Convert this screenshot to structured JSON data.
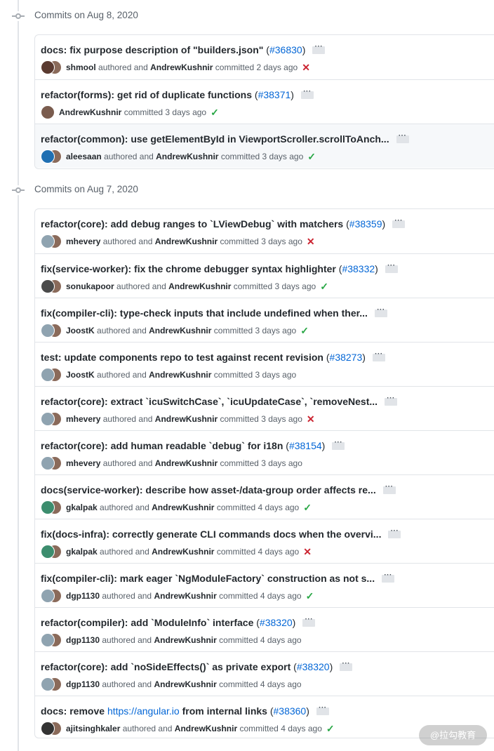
{
  "colors": {
    "link": "#0366d6",
    "fail": "#cb2431",
    "success": "#28a745",
    "border": "#e1e4e8",
    "muted": "#586069"
  },
  "groups": [
    {
      "heading": "Commits on Aug 8, 2020",
      "commits": [
        {
          "title": "docs: fix purpose description of \"builders.json\"",
          "pr": "#36830",
          "author": "shmool",
          "verb": "authored and",
          "committer": "AndrewKushnir",
          "action": "committed",
          "time": "2 days ago",
          "status": "fail",
          "avatar_color": "#5a3a30"
        },
        {
          "title": "refactor(forms): get rid of duplicate functions",
          "pr": "#38371",
          "author": "AndrewKushnir",
          "verb": "",
          "committer": "",
          "action": "committed",
          "time": "3 days ago",
          "status": "success",
          "avatar_color": "#7a5c4e"
        },
        {
          "title": "refactor(common): use getElementById in ViewportScroller.scrollToAnch...",
          "pr": "",
          "author": "aleesaan",
          "verb": "authored and",
          "committer": "AndrewKushnir",
          "action": "committed",
          "time": "3 days ago",
          "status": "success",
          "avatar_color": "#1f6fb2"
        }
      ]
    },
    {
      "heading": "Commits on Aug 7, 2020",
      "commits": [
        {
          "title": "refactor(core): add debug ranges to `LViewDebug` with matchers",
          "pr": "#38359",
          "author": "mhevery",
          "verb": "authored and",
          "committer": "AndrewKushnir",
          "action": "committed",
          "time": "3 days ago",
          "status": "fail",
          "avatar_color": "#8fa3b0"
        },
        {
          "title": "fix(service-worker): fix the chrome debugger syntax highlighter",
          "pr": "#38332",
          "author": "sonukapoor",
          "verb": "authored and",
          "committer": "AndrewKushnir",
          "action": "committed",
          "time": "3 days ago",
          "status": "success",
          "avatar_color": "#4a4a4a"
        },
        {
          "title": "fix(compiler-cli): type-check inputs that include undefined when ther...",
          "pr": "",
          "author": "JoostK",
          "verb": "authored and",
          "committer": "AndrewKushnir",
          "action": "committed",
          "time": "3 days ago",
          "status": "success",
          "avatar_color": "#8fa3b0"
        },
        {
          "title": "test: update components repo to test against recent revision",
          "pr": "#38273",
          "author": "JoostK",
          "verb": "authored and",
          "committer": "AndrewKushnir",
          "action": "committed",
          "time": "3 days ago",
          "status": "none",
          "avatar_color": "#8fa3b0"
        },
        {
          "title": "refactor(core): extract `icuSwitchCase`, `icuUpdateCase`, `removeNest...",
          "pr": "",
          "author": "mhevery",
          "verb": "authored and",
          "committer": "AndrewKushnir",
          "action": "committed",
          "time": "3 days ago",
          "status": "fail",
          "avatar_color": "#8fa3b0"
        },
        {
          "title": "refactor(core): add human readable `debug` for i18n",
          "pr": "#38154",
          "author": "mhevery",
          "verb": "authored and",
          "committer": "AndrewKushnir",
          "action": "committed",
          "time": "3 days ago",
          "status": "none",
          "avatar_color": "#8fa3b0"
        },
        {
          "title": "docs(service-worker): describe how asset-/data-group order affects re...",
          "pr": "",
          "author": "gkalpak",
          "verb": "authored and",
          "committer": "AndrewKushnir",
          "action": "committed",
          "time": "4 days ago",
          "status": "success",
          "avatar_color": "#3c8d6e"
        },
        {
          "title": "fix(docs-infra): correctly generate CLI commands docs when the overvi...",
          "pr": "",
          "author": "gkalpak",
          "verb": "authored and",
          "committer": "AndrewKushnir",
          "action": "committed",
          "time": "4 days ago",
          "status": "fail",
          "avatar_color": "#3c8d6e"
        },
        {
          "title": "fix(compiler-cli): mark eager `NgModuleFactory` construction as not s...",
          "pr": "",
          "author": "dgp1130",
          "verb": "authored and",
          "committer": "AndrewKushnir",
          "action": "committed",
          "time": "4 days ago",
          "status": "success",
          "avatar_color": "#8fa3b0"
        },
        {
          "title": "refactor(compiler): add `ModuleInfo` interface",
          "pr": "#38320",
          "author": "dgp1130",
          "verb": "authored and",
          "committer": "AndrewKushnir",
          "action": "committed",
          "time": "4 days ago",
          "status": "none",
          "avatar_color": "#8fa3b0"
        },
        {
          "title": "refactor(core): add `noSideEffects()` as private export",
          "pr": "#38320",
          "author": "dgp1130",
          "verb": "authored and",
          "committer": "AndrewKushnir",
          "action": "committed",
          "time": "4 days ago",
          "status": "none",
          "avatar_color": "#8fa3b0"
        },
        {
          "title": "docs: remove",
          "link": "https://angular.io",
          "title_after": "from internal links",
          "pr": "#38360",
          "author": "ajitsinghkaler",
          "verb": "authored and",
          "committer": "AndrewKushnir",
          "action": "committed",
          "time": "4 days ago",
          "status": "success",
          "avatar_color": "#333333"
        }
      ]
    }
  ],
  "watermark": "@拉勾教育"
}
